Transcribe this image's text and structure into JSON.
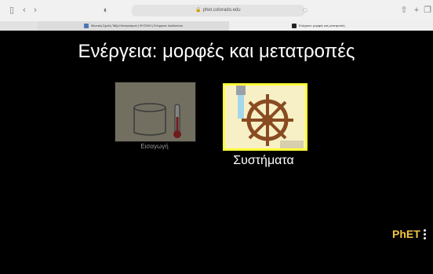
{
  "browser": {
    "url": "phet.colorado.edu",
    "tabs": [
      {
        "label": "Ιδιωτική Σχολή Τάξη Ηλεκτρισμού | ΦΥΣΙΚΗ | Ενέργεια: Διαδικτύου"
      },
      {
        "label": "Ενέργεια: μορφές και μετατροπές"
      }
    ],
    "icons": [
      "sidebar-icon",
      "back-icon",
      "forward-icon",
      "shield-icon",
      "lock-icon",
      "reader-icon",
      "share-icon",
      "new-tab-icon",
      "tabs-overview-icon"
    ]
  },
  "sim": {
    "title": "Ενέργεια: μορφές και μετατροπές",
    "screens": [
      {
        "label": "Εισαγωγή",
        "selected": false
      },
      {
        "label": "Συστήματα",
        "selected": true
      }
    ],
    "logo": "PhET"
  },
  "colors": {
    "accent": "#ffff3a",
    "logo": "#f4c542"
  }
}
